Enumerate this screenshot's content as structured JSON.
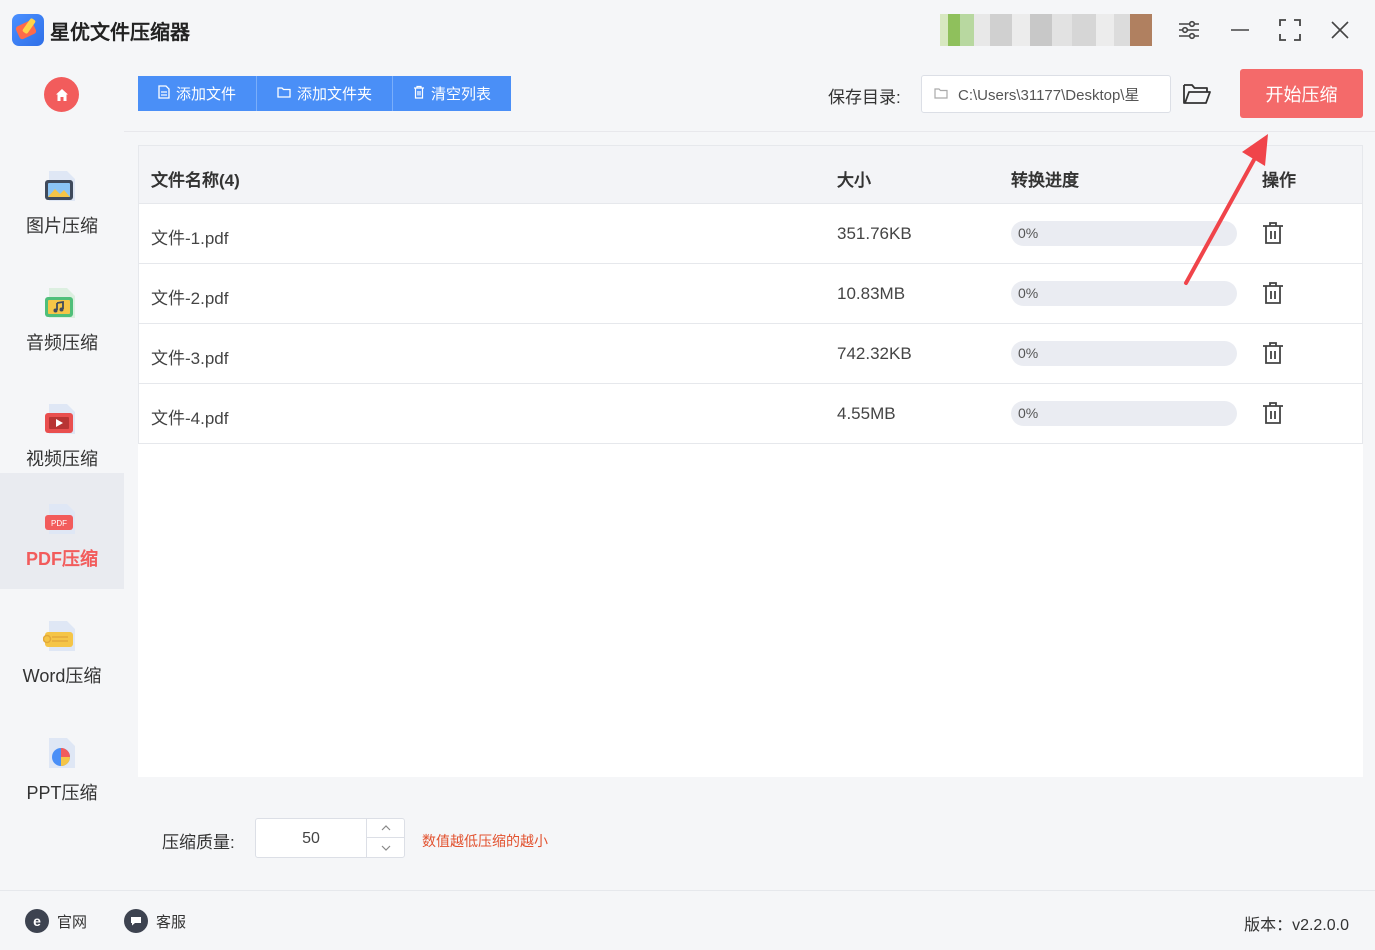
{
  "app": {
    "title": "星优文件压缩器"
  },
  "window": {
    "settings_icon": "sliders-icon",
    "minimize_icon": "minimize-icon",
    "maximize_icon": "maximize-icon",
    "close_icon": "close-icon"
  },
  "sidebar": {
    "items": [
      {
        "label": "图片压缩",
        "icon": "image-icon",
        "active": false
      },
      {
        "label": "音频压缩",
        "icon": "music-icon",
        "active": false
      },
      {
        "label": "视频压缩",
        "icon": "video-icon",
        "active": false
      },
      {
        "label": "PDF压缩",
        "icon": "pdf-icon",
        "active": true
      },
      {
        "label": "Word压缩",
        "icon": "word-icon",
        "active": false
      },
      {
        "label": "PPT压缩",
        "icon": "ppt-icon",
        "active": false
      }
    ]
  },
  "toolbar": {
    "add_file": "添加文件",
    "add_folder": "添加文件夹",
    "clear_list": "清空列表",
    "save_label": "保存目录:",
    "save_path": "C:\\Users\\31177\\Desktop\\星",
    "start": "开始压缩"
  },
  "table": {
    "headers": {
      "name": "文件名称(4)",
      "size": "大小",
      "progress": "转换进度",
      "action": "操作"
    },
    "rows": [
      {
        "name": "文件-1.pdf",
        "size": "351.76KB",
        "progress": "0%",
        "progress_value": 0
      },
      {
        "name": "文件-2.pdf",
        "size": "10.83MB",
        "progress": "0%",
        "progress_value": 0
      },
      {
        "name": "文件-3.pdf",
        "size": "742.32KB",
        "progress": "0%",
        "progress_value": 0
      },
      {
        "name": "文件-4.pdf",
        "size": "4.55MB",
        "progress": "0%",
        "progress_value": 0
      }
    ]
  },
  "settings": {
    "quality_label": "压缩质量:",
    "quality_value": "50",
    "quality_hint": "数值越低压缩的越小"
  },
  "statusbar": {
    "website": "官网",
    "support": "客服",
    "version": "版本：v2.2.0.0"
  },
  "colors": {
    "accent": "#4a8ff7",
    "danger": "#f46a6a",
    "hint": "#e2522f"
  }
}
